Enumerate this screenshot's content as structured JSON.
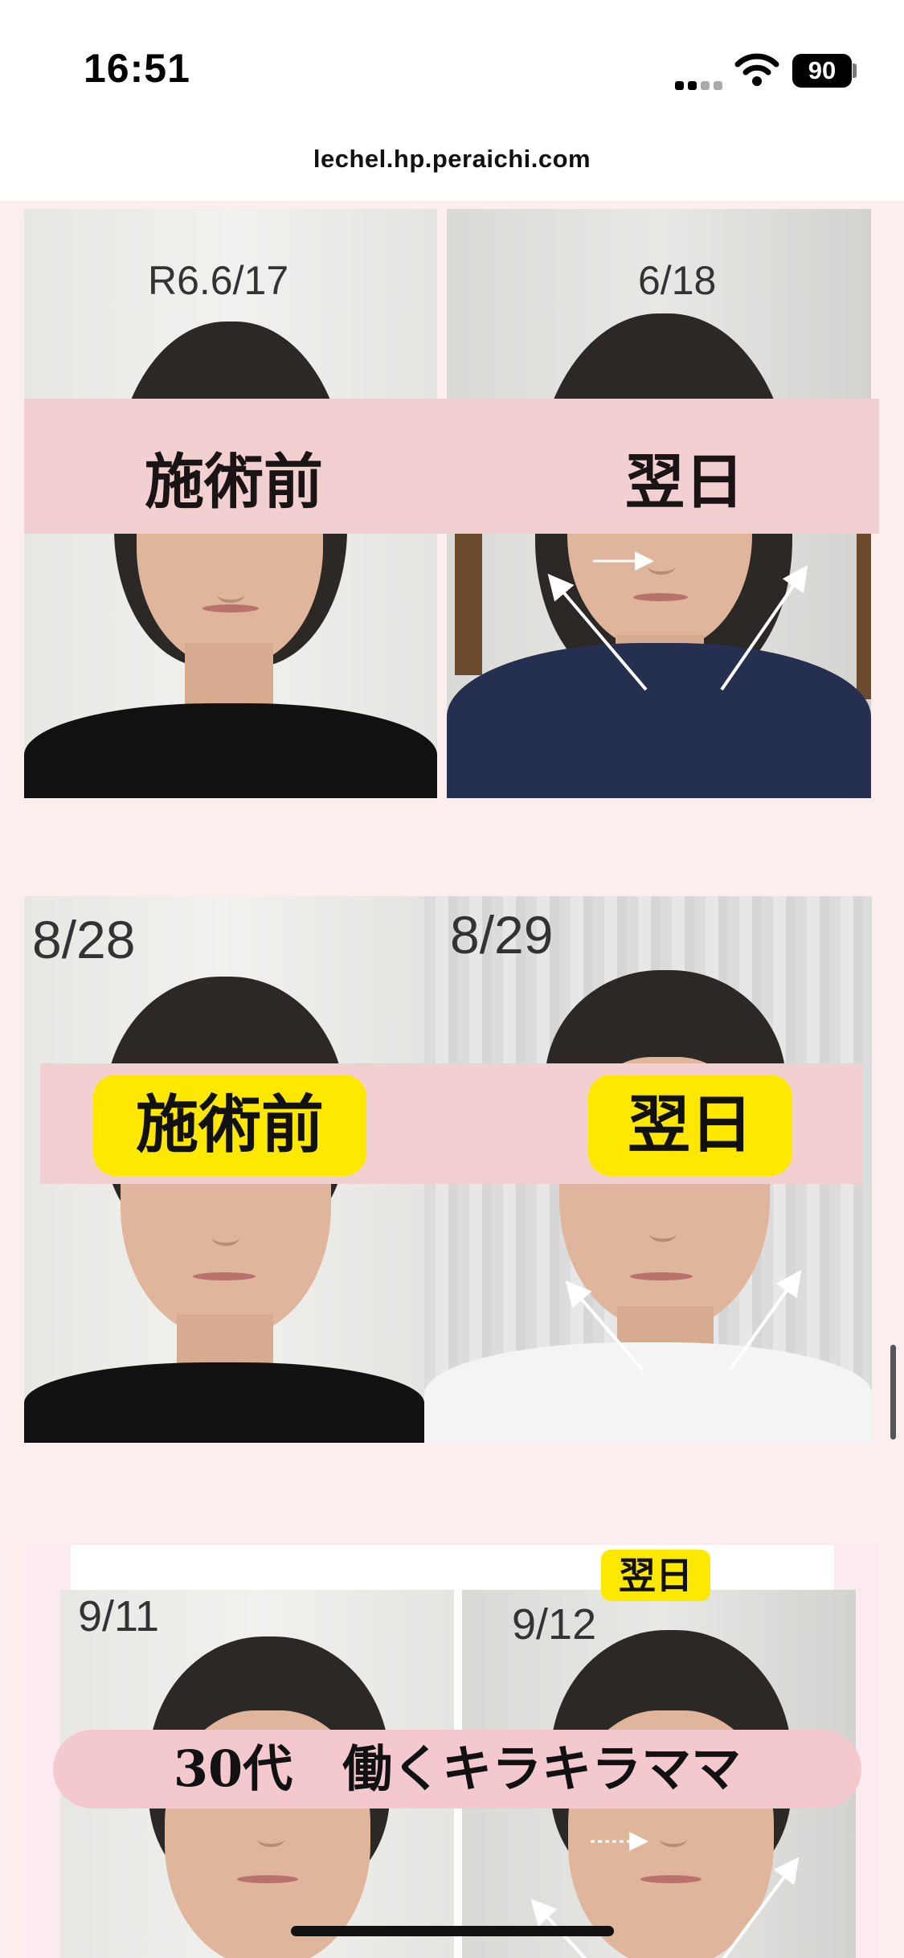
{
  "status_bar": {
    "time": "16:51",
    "battery": "90",
    "icons": [
      "cellular-signal-icon",
      "wifi-icon",
      "battery-icon"
    ]
  },
  "browser": {
    "url": "lechel.hp.peraichi.com"
  },
  "sections": [
    {
      "before": {
        "date": "R6.6/17"
      },
      "after": {
        "date": "6/18"
      },
      "band_left": "施術前",
      "band_right": "翌日"
    },
    {
      "before": {
        "date": "8/28"
      },
      "after": {
        "date": "8/29"
      },
      "band_left": "施術前",
      "band_right": "翌日"
    },
    {
      "before": {
        "date": "9/11"
      },
      "after": {
        "date": "9/12"
      },
      "tag": "翌日",
      "caption": "30代　働くキラキラママ"
    }
  ],
  "colors": {
    "page_bg": "#fdeeee",
    "band_pink": "#f2cfd0",
    "highlight_yellow": "#ffe800"
  }
}
